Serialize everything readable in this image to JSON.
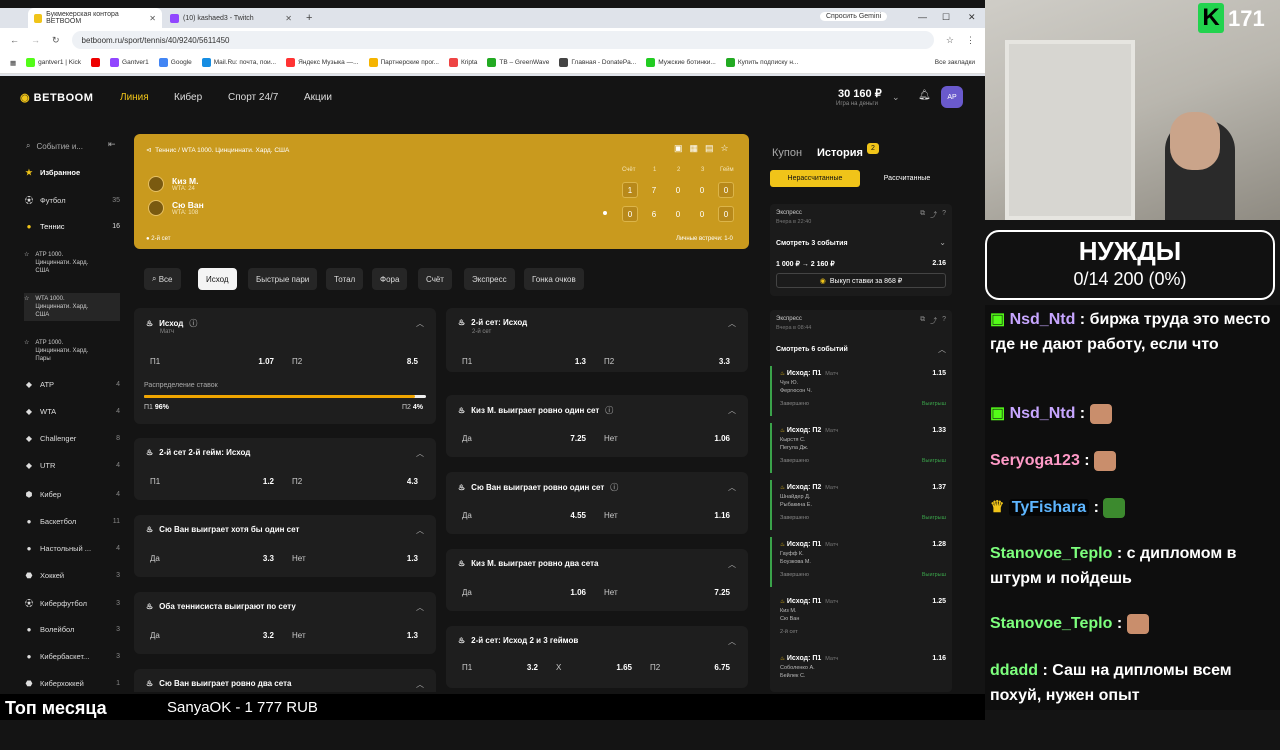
{
  "browser": {
    "tabs": [
      {
        "label": "Букмекерская контора BETBOOM",
        "active": true
      },
      {
        "label": "(10) kashaed3 - Twitch",
        "active": false
      }
    ],
    "url": "betboom.ru/sport/tennis/40/9240/5611450",
    "gemini": "Спросить Gemini",
    "bookmarks": [
      "gantver1 | Kick",
      "Gantver1",
      "Google",
      "Mail.Ru: почта, пои...",
      "Яндекс Музыка —...",
      "Партнерские прог...",
      "Кripta",
      "TB – GreenWave",
      "Главная - DonatePa...",
      "Мужские ботинки...",
      "Купить подписку н..."
    ],
    "all_bookmarks": "Все закладки"
  },
  "site": {
    "logo": "BETBOOM",
    "nav": [
      "Линия",
      "Кибер",
      "Спорт 24/7",
      "Акции"
    ],
    "balance": "30 160 ₽",
    "balance_sub": "Игра на деньги",
    "avatar": "AP"
  },
  "sidebar": {
    "search_placeholder": "Событие и...",
    "items": [
      {
        "label": "Избранное",
        "count": "",
        "top": 0
      },
      {
        "label": "Футбол",
        "count": "35"
      },
      {
        "label": "Теннис",
        "count": "16"
      }
    ],
    "tennis_subs": [
      "ATP 1000. Цинциннати. Хард. США",
      "WTA 1000. Цинциннати. Хард. США",
      "ATP 1000. Цинциннати. Хард. Пары"
    ],
    "sports": [
      {
        "label": "ATP",
        "count": "4"
      },
      {
        "label": "WTA",
        "count": "4"
      },
      {
        "label": "Challenger",
        "count": "8"
      },
      {
        "label": "UTR",
        "count": "4"
      },
      {
        "label": "Кибер",
        "count": "4"
      },
      {
        "label": "Баскетбол",
        "count": "11"
      },
      {
        "label": "Настольный ...",
        "count": "4"
      },
      {
        "label": "Хоккей",
        "count": "3"
      },
      {
        "label": "Киберфутбол",
        "count": "3"
      },
      {
        "label": "Волейбол",
        "count": "3"
      },
      {
        "label": "Кибербаскет...",
        "count": "3"
      },
      {
        "label": "Киберхоккей",
        "count": "1"
      }
    ]
  },
  "event": {
    "breadcrumb": "Теннис  /  WTA 1000. Цинциннати. Хард. США",
    "p1": {
      "name": "Киз М.",
      "rank": "WTA: 24"
    },
    "p2": {
      "name": "Сю Ван",
      "rank": "WTA: 108"
    },
    "score_headers": [
      "Счёт",
      "1",
      "2",
      "3",
      "Гейм"
    ],
    "p1_scores": [
      "1",
      "7",
      "0",
      "0",
      "0"
    ],
    "p2_scores": [
      "0",
      "6",
      "0",
      "0",
      "0"
    ],
    "status": "2-й сет",
    "h2h": "Личные встречи: 1-0"
  },
  "filters": [
    "Все",
    "Исход",
    "Быстрые пари",
    "Тотал",
    "Фора",
    "Счёт",
    "Экспресс",
    "Гонка очков"
  ],
  "markets": {
    "outcome": {
      "title": "Исход",
      "sub": "Матч",
      "o1": "П1",
      "v1": "1.07",
      "o2": "П2",
      "v2": "8.5"
    },
    "distribution": {
      "title": "Распределение ставок",
      "p1": "П1",
      "p1v": "96%",
      "p2": "П2",
      "p2v": "4%",
      "fill": 0.96
    },
    "set2game2": {
      "title": "2-й сет 2-й гейм: Исход",
      "o1": "П1",
      "v1": "1.2",
      "o2": "П2",
      "v2": "4.3"
    },
    "su_one_set": {
      "title": "Сю Ван выиграет хотя бы один сет",
      "o1": "Да",
      "v1": "3.3",
      "o2": "Нет",
      "v2": "1.3"
    },
    "both_set": {
      "title": "Оба теннисиста выиграют по сету",
      "o1": "Да",
      "v1": "3.2",
      "o2": "Нет",
      "v2": "1.3"
    },
    "su_two": {
      "title": "Сю Ван выиграет ровно два сета"
    },
    "set2": {
      "title": "2-й сет: Исход",
      "sub": "2-й сет",
      "o1": "П1",
      "v1": "1.3",
      "o2": "П2",
      "v2": "3.3"
    },
    "kiz_one": {
      "title": "Киз М. выиграет ровно один сет",
      "o1": "Да",
      "v1": "7.25",
      "o2": "Нет",
      "v2": "1.06"
    },
    "su_one": {
      "title": "Сю Ван выиграет ровно один сет",
      "o1": "Да",
      "v1": "4.55",
      "o2": "Нет",
      "v2": "1.16"
    },
    "kiz_two": {
      "title": "Киз М. выиграет ровно два сета",
      "o1": "Да",
      "v1": "1.06",
      "o2": "Нет",
      "v2": "7.25"
    },
    "set2_g23": {
      "title": "2-й сет: Исход 2 и 3 геймов",
      "o1": "П1",
      "v1": "3.2",
      "ox": "X",
      "vx": "1.65",
      "o2": "П2",
      "v2": "6.75"
    }
  },
  "coupon": {
    "tab1": "Купон",
    "tab2": "История",
    "badge": "2",
    "seg1": "Нерассчитанные",
    "seg2": "Рассчитанные",
    "exp1": {
      "type": "Экспресс",
      "date": "Вчера в 22:40",
      "see": "Смотреть 3 события",
      "amount": "1 000 ₽ → 2 160 ₽",
      "k": "2.16",
      "cashout": "Выкуп ставки за 868 ₽"
    },
    "exp2": {
      "type": "Экспресс",
      "date": "Вчера в 08:44",
      "see": "Смотреть 6 событий"
    },
    "legs": [
      {
        "h": "Исход: П1",
        "tag": "Матч",
        "k": "1.15",
        "a": "Чун Ю.",
        "b": "Фергюсон Ч.",
        "st": "Завершено",
        "win": "Выигрыш"
      },
      {
        "h": "Исход: П2",
        "tag": "Матч",
        "k": "1.33",
        "a": "Кырстя С.",
        "b": "Пегула Дж.",
        "st": "Завершено",
        "win": "Выигрыш"
      },
      {
        "h": "Исход: П2",
        "tag": "Матч",
        "k": "1.37",
        "a": "Шнайдер Д.",
        "b": "Рыбакина Е.",
        "st": "Завершено",
        "win": "Выигрыш"
      },
      {
        "h": "Исход: П1",
        "tag": "Матч",
        "k": "1.28",
        "a": "Гауфф К.",
        "b": "Боузкова М.",
        "st": "Завершено",
        "win": "Выигрыш"
      },
      {
        "h": "Исход: П1",
        "tag": "Матч",
        "k": "1.25",
        "a": "Киз М.",
        "b": "Сю Ван",
        "st": "2-й сет",
        "win": ""
      },
      {
        "h": "Исход: П1",
        "tag": "Матч",
        "k": "1.16",
        "a": "Соболенко А.",
        "b": "Бейлек С.",
        "st": "",
        "win": ""
      }
    ]
  },
  "stream": {
    "viewers": "171",
    "goal_title": "НУЖДЫ",
    "goal_value": "0/14 200 (0%)",
    "chat": [
      {
        "user": "Nsd_Ntd",
        "text": "биржа труда это место где не дают работу, если что"
      },
      {
        "user": "Nsd_Ntd",
        "text": ""
      },
      {
        "user": "Seryoga123",
        "text": ""
      },
      {
        "user": "TyFishara",
        "text": ""
      },
      {
        "user": "Stanovoe_Teplo",
        "text": "с дипломом в штурм и пойдешь"
      },
      {
        "user": "Stanovoe_Teplo",
        "text": ""
      },
      {
        "user": "ddadd",
        "text": "Саш на дипломы всем похуй, нужен опыт"
      }
    ],
    "ticker_title": "Топ месяца",
    "ticker_text": "SanyaOK - 1 777 RUB"
  }
}
